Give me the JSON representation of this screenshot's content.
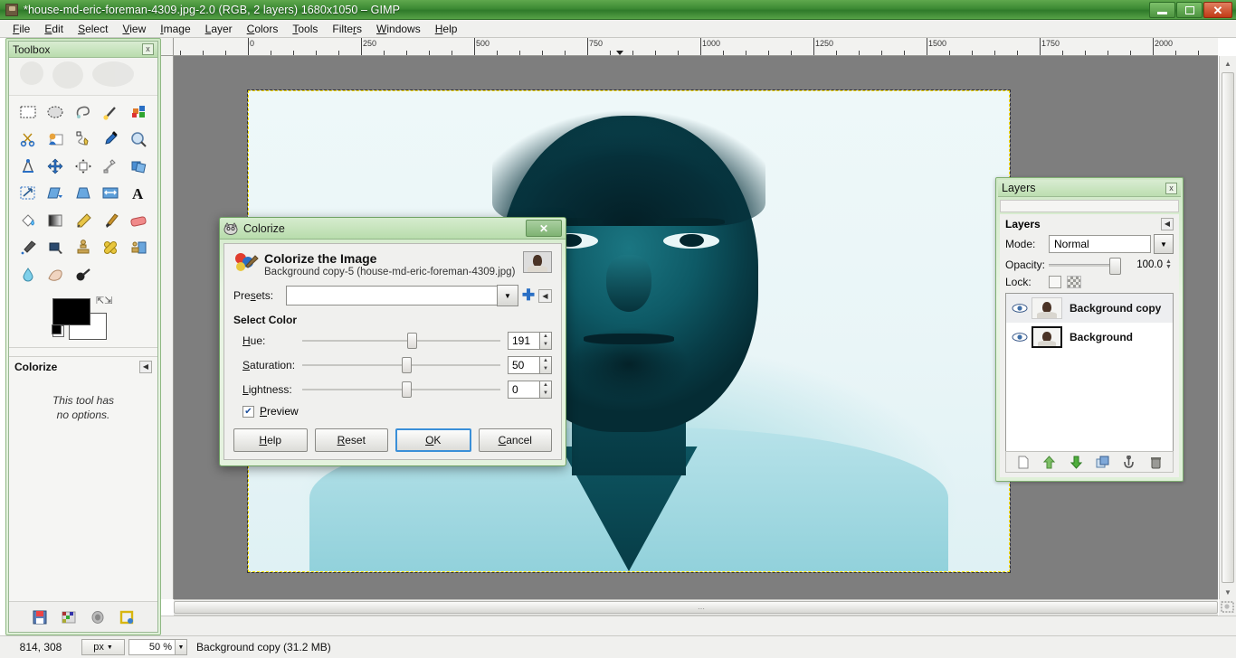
{
  "window": {
    "title": "*house-md-eric-foreman-4309.jpg-2.0 (RGB, 2 layers) 1680x1050 – GIMP",
    "icon": "gimp-wilber-icon",
    "buttons": {
      "minimize": "minimize-button",
      "maximize": "restore-button",
      "close": "close-button"
    }
  },
  "menubar": {
    "items": [
      {
        "label": "File",
        "mnemonic": "F"
      },
      {
        "label": "Edit",
        "mnemonic": "E"
      },
      {
        "label": "Select",
        "mnemonic": "S"
      },
      {
        "label": "View",
        "mnemonic": "V"
      },
      {
        "label": "Image",
        "mnemonic": "I"
      },
      {
        "label": "Layer",
        "mnemonic": "L"
      },
      {
        "label": "Colors",
        "mnemonic": "C"
      },
      {
        "label": "Tools",
        "mnemonic": "T"
      },
      {
        "label": "Filters",
        "mnemonic": "R"
      },
      {
        "label": "Windows",
        "mnemonic": "W"
      },
      {
        "label": "Help",
        "mnemonic": "H"
      }
    ]
  },
  "toolbox": {
    "title": "Toolbox",
    "close_label": "x",
    "tools": [
      "rect-select-tool",
      "ellipse-select-tool",
      "free-select-tool",
      "fuzzy-select-tool",
      "select-by-color-tool",
      "scissors-select-tool",
      "foreground-select-tool",
      "paths-tool",
      "color-picker-tool",
      "zoom-tool",
      "measure-tool",
      "move-tool",
      "alignment-tool",
      "crop-tool",
      "rotate-tool",
      "scale-tool",
      "shear-tool",
      "perspective-tool",
      "flip-tool",
      "text-tool",
      "bucket-fill-tool",
      "blend-gradient-tool",
      "pencil-tool",
      "paintbrush-tool",
      "eraser-tool",
      "airbrush-tool",
      "ink-tool",
      "clone-tool",
      "heal-tool",
      "perspective-clone-tool",
      "blur-sharpen-tool",
      "smudge-tool",
      "dodge-burn-tool"
    ],
    "colors": {
      "foreground": "#000000",
      "background": "#ffffff",
      "swap_icon": "swap-colors-icon",
      "reset_icon": "reset-colors-icon"
    },
    "bottom_icons": [
      "save-device-status-icon",
      "pattern-icon",
      "brush-icon",
      "restore-icon"
    ]
  },
  "tool_options": {
    "title": "Colorize",
    "menu_icon": "tool-options-menu-icon",
    "message_line1": "This tool has",
    "message_line2": "no options."
  },
  "canvas": {
    "ruler_unit": "px",
    "ruler_ticks": [
      0,
      250,
      500,
      750,
      1000,
      1250,
      1500,
      1750,
      2000
    ],
    "selection_border": "#ffe200",
    "image_background": "#eef7f8"
  },
  "statusbar": {
    "position": "814, 308",
    "unit": "px",
    "zoom": "50 %",
    "text": "Background copy (31.2 MB)"
  },
  "layers_dock": {
    "title": "Layers",
    "close_label": "x",
    "section_label": "Layers",
    "menu_icon": "layers-menu-icon",
    "mode_label": "Mode:",
    "mode_value": "Normal",
    "opacity_label": "Opacity:",
    "opacity_value": "100.0",
    "lock_label": "Lock:",
    "lock_pixels_icon": "lock-pixels-icon",
    "lock_alpha_icon": "lock-alpha-icon",
    "items": [
      {
        "name": "Background copy",
        "visible": true,
        "selected": true
      },
      {
        "name": "Background",
        "visible": true,
        "selected": false
      }
    ],
    "toolbar_icons": [
      "new-layer-icon",
      "raise-layer-icon",
      "lower-layer-icon",
      "duplicate-layer-icon",
      "anchor-layer-icon",
      "delete-layer-icon"
    ]
  },
  "dialog": {
    "title": "Colorize",
    "title_icon": "gimp-wilber-icon",
    "close_label": "x",
    "heading": "Colorize the Image",
    "subheading": "Background copy-5 (house-md-eric-foreman-4309.jpg)",
    "header_icon": "colorize-icon",
    "preview_thumb": "image-preview-thumbnail",
    "presets": {
      "label": "Presets:",
      "mnemonic": "s",
      "value": "",
      "dropdown_icon": "chevron-down-icon",
      "add_icon": "plus-icon",
      "menu_icon": "preset-menu-icon"
    },
    "section": "Select Color",
    "sliders": [
      {
        "label": "Hue:",
        "mnemonic": "H",
        "value": "191",
        "percent": 53
      },
      {
        "label": "Saturation:",
        "mnemonic": "S",
        "value": "50",
        "percent": 50
      },
      {
        "label": "Lightness:",
        "mnemonic": "L",
        "value": "0",
        "percent": 50
      }
    ],
    "preview": {
      "label": "Preview",
      "mnemonic": "P",
      "checked": true,
      "check_glyph": "✔"
    },
    "buttons": [
      {
        "label": "Help",
        "mnemonic": "H",
        "default": false
      },
      {
        "label": "Reset",
        "mnemonic": "R",
        "default": false
      },
      {
        "label": "OK",
        "mnemonic": "O",
        "default": true
      },
      {
        "label": "Cancel",
        "mnemonic": "C",
        "default": false
      }
    ]
  }
}
